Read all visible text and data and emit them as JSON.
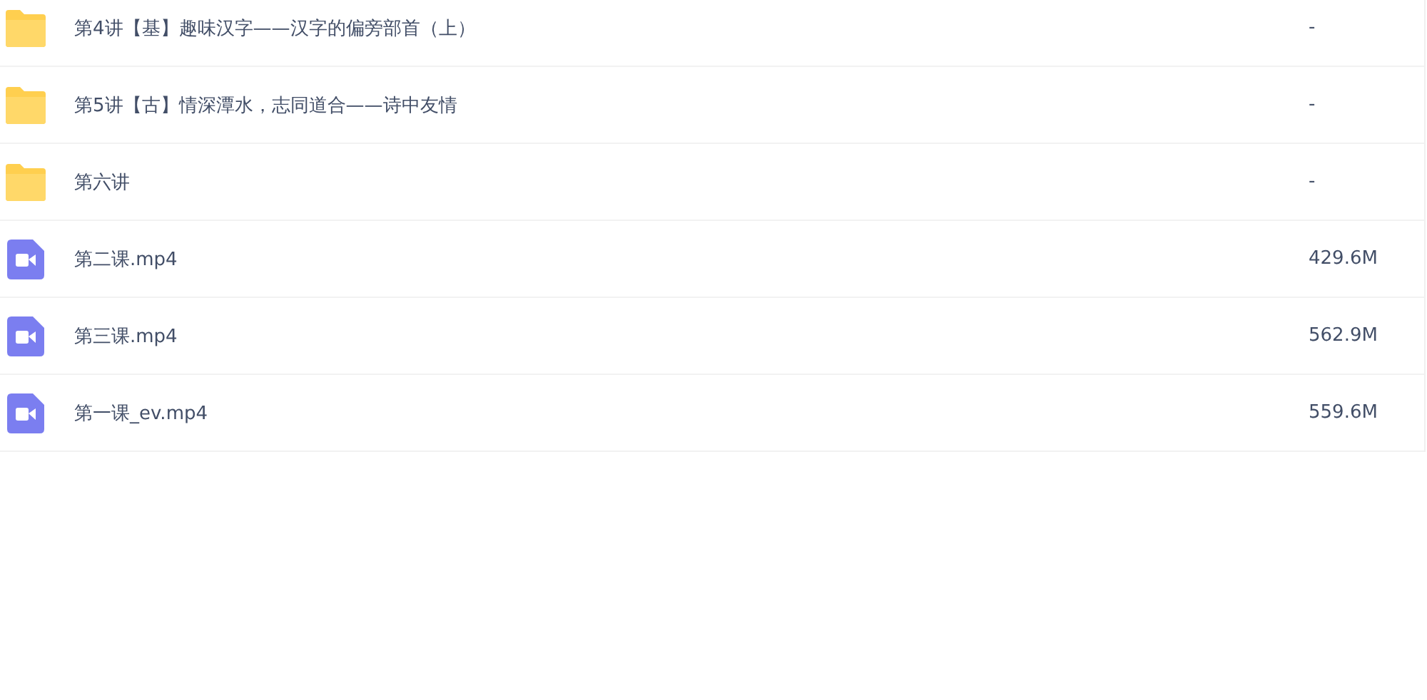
{
  "files": [
    {
      "kind": "folder",
      "name": "第4讲【基】趣味汉字——汉字的偏旁部首（上）",
      "size": "-"
    },
    {
      "kind": "folder",
      "name": "第5讲【古】情深潭水，志同道合——诗中友情",
      "size": "-"
    },
    {
      "kind": "folder",
      "name": "第六讲",
      "size": "-"
    },
    {
      "kind": "video",
      "name": "第二课.mp4",
      "size": "429.6M"
    },
    {
      "kind": "video",
      "name": "第三课.mp4",
      "size": "562.9M"
    },
    {
      "kind": "video",
      "name": "第一课_ev.mp4",
      "size": "559.6M"
    }
  ]
}
